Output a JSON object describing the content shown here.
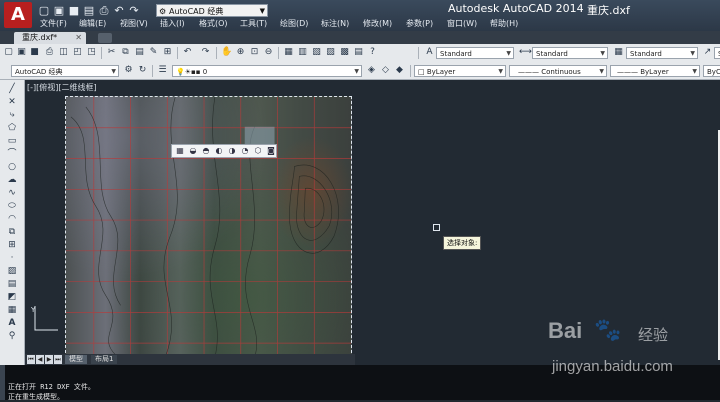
{
  "titlebar": {
    "logo": "A",
    "workspace": "AutoCAD 经典",
    "app_title": "Autodesk AutoCAD 2014",
    "doc_title": "重庆.dxf"
  },
  "menu": [
    "文件(F)",
    "编辑(E)",
    "视图(V)",
    "插入(I)",
    "格式(O)",
    "工具(T)",
    "绘图(D)",
    "标注(N)",
    "修改(M)",
    "参数(P)",
    "窗口(W)",
    "帮助(H)"
  ],
  "tabs": {
    "document": "重庆.dxf*"
  },
  "styles_toolbar": {
    "text_style": "Standard",
    "dim_style": "Standard",
    "table_style": "Standard",
    "multileader_style": "Standard"
  },
  "layers_toolbar": {
    "workspace": "AutoCAD 经典",
    "layer": "0",
    "color": "ByLayer",
    "linetype": "Continuous",
    "lineweight": "ByLayer",
    "plotstyle": "ByC"
  },
  "viewport": {
    "label": "[-][俯视][二维线框]"
  },
  "drawing": {
    "tooltip": "选择对象:"
  },
  "layout_tabs": {
    "model": "模型",
    "layout1": "布局1"
  },
  "command": {
    "line1": "正在打开 R12 DXF 文件。",
    "line2": "正在重生成模型。"
  },
  "watermark": {
    "brand": "Bai",
    "brand_sub": "经验",
    "url": "jingyan.baidu.com"
  },
  "colors": {
    "drawing_bg": "#222a33",
    "title_bg": "#2c3847",
    "logo": "#b81f1f",
    "toolbar_bg": "#e6e9ec"
  }
}
